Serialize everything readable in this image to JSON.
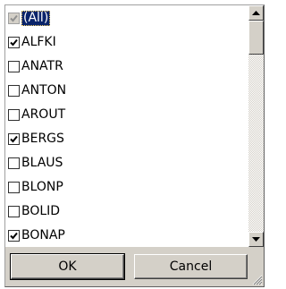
{
  "list": {
    "items": [
      {
        "label": "(All)",
        "checked": true,
        "selected": true,
        "disabled": true
      },
      {
        "label": "ALFKI",
        "checked": true
      },
      {
        "label": "ANATR",
        "checked": false
      },
      {
        "label": "ANTON",
        "checked": false
      },
      {
        "label": "AROUT",
        "checked": false
      },
      {
        "label": "BERGS",
        "checked": true
      },
      {
        "label": "BLAUS",
        "checked": false
      },
      {
        "label": "BLONP",
        "checked": false
      },
      {
        "label": "BOLID",
        "checked": false
      },
      {
        "label": "BONAP",
        "checked": true
      }
    ]
  },
  "buttons": {
    "ok_label": "OK",
    "cancel_label": "Cancel"
  },
  "icons": {
    "check": "check-icon",
    "scroll_up": "arrow-up-icon",
    "scroll_down": "arrow-down-icon",
    "resize": "resize-grip-icon"
  },
  "colors": {
    "selection_bg": "#0a246a",
    "selection_fg": "#ffffff",
    "face": "#d4d0c8"
  }
}
